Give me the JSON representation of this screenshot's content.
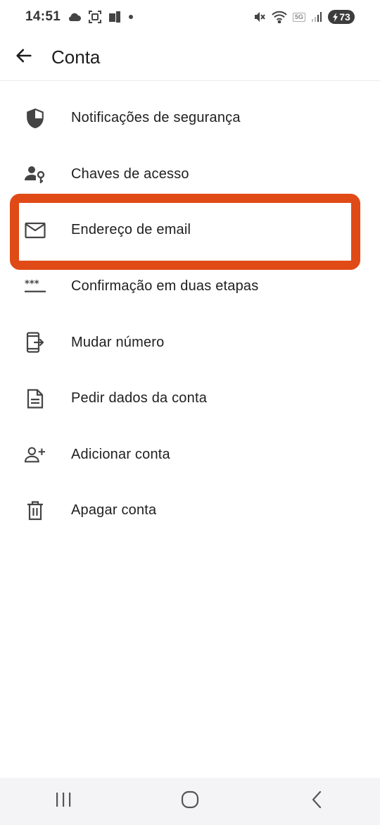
{
  "status_bar": {
    "time": "14:51",
    "network_tag": "5G",
    "battery_level": "73",
    "icons": [
      "cloud-icon",
      "screenshot-icon",
      "sim-icon",
      "dot-icon",
      "mute-icon",
      "wifi-icon",
      "signal-icon",
      "battery-icon"
    ]
  },
  "app_bar": {
    "title": "Conta",
    "back_icon": "arrow-left-icon"
  },
  "menu": {
    "items": [
      {
        "label": "Notificações de segurança",
        "icon": "shield-icon"
      },
      {
        "label": "Chaves de acesso",
        "icon": "person-key-icon"
      },
      {
        "label": "Endereço de email",
        "icon": "mail-icon"
      },
      {
        "label": "Confirmação em duas etapas",
        "icon": "password-dots-icon"
      },
      {
        "label": "Mudar número",
        "icon": "phone-transfer-icon"
      },
      {
        "label": "Pedir dados da conta",
        "icon": "document-icon"
      },
      {
        "label": "Adicionar conta",
        "icon": "add-person-icon"
      },
      {
        "label": "Apagar conta",
        "icon": "trash-icon"
      }
    ]
  },
  "highlight": {
    "target": "Endereço de email",
    "color": "#e04a16"
  },
  "nav_bar": {
    "buttons": [
      "recents-icon",
      "home-icon",
      "back-icon"
    ]
  }
}
